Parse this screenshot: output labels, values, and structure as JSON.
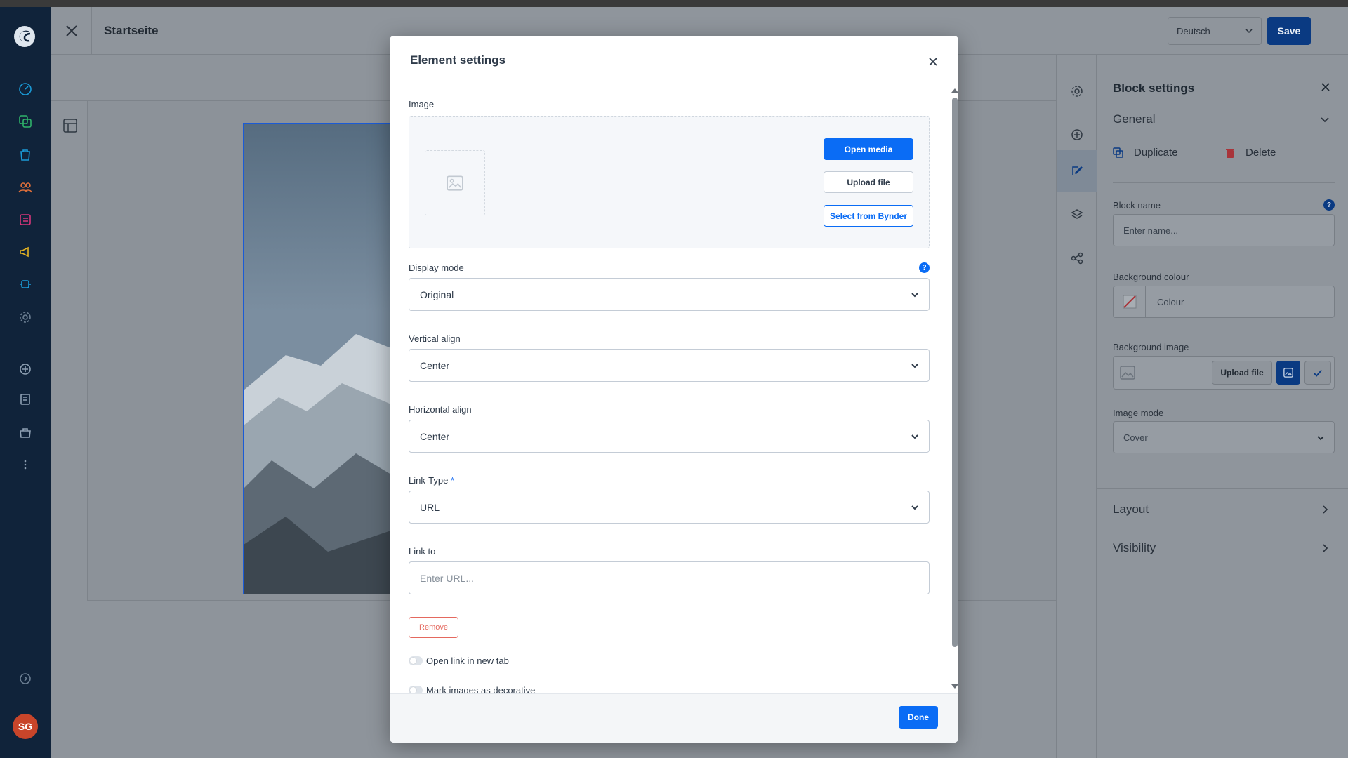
{
  "header": {
    "title": "Startseite",
    "language": "Deutsch",
    "save_label": "Save"
  },
  "sidebar": {
    "avatar_initials": "SG",
    "icons": [
      "dashboard-icon",
      "catalogue-icon",
      "orders-icon",
      "customers-icon",
      "content-icon",
      "marketing-icon",
      "extensions-icon",
      "settings-icon",
      "add-icon",
      "sales-channel-icon",
      "shop-icon",
      "more-icon",
      "help-icon"
    ]
  },
  "modal": {
    "title": "Element settings",
    "image_label": "Image",
    "open_media": "Open media",
    "upload_file": "Upload file",
    "select_bynder": "Select from Bynder",
    "display_mode_label": "Display mode",
    "display_mode_value": "Original",
    "vertical_align_label": "Vertical align",
    "vertical_align_value": "Center",
    "horizontal_align_label": "Horizontal align",
    "horizontal_align_value": "Center",
    "link_type_label": "Link-Type",
    "link_type_required": "*",
    "link_type_value": "URL",
    "link_to_label": "Link to",
    "link_to_placeholder": "Enter URL...",
    "remove_label": "Remove",
    "open_new_tab_label": "Open link in new tab",
    "mark_decorative_label": "Mark images as decorative",
    "done_label": "Done"
  },
  "block_settings": {
    "title": "Block settings",
    "general_label": "General",
    "duplicate_label": "Duplicate",
    "delete_label": "Delete",
    "block_name_label": "Block name",
    "block_name_placeholder": "Enter name...",
    "bg_colour_label": "Background colour",
    "bg_colour_placeholder": "Colour",
    "bg_image_label": "Background image",
    "upload_file": "Upload file",
    "image_mode_label": "Image mode",
    "image_mode_value": "Cover",
    "layout_label": "Layout",
    "visibility_label": "Visibility"
  },
  "colors": {
    "primary": "#0a6cf5",
    "sidebar": "#10233a",
    "remove": "#e4695f",
    "avatar": "#c8452a"
  }
}
